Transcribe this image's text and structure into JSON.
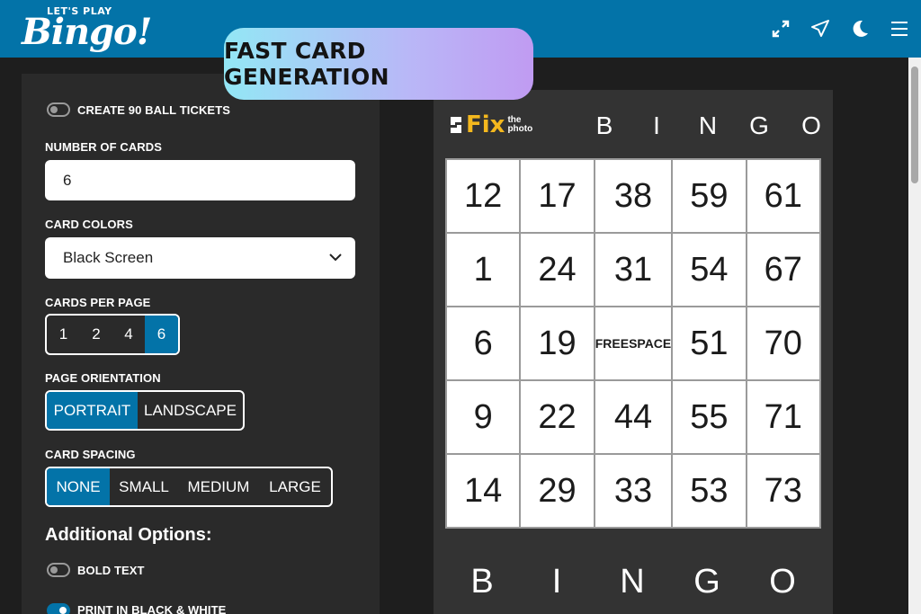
{
  "header": {
    "logo_small": "LET'S PLAY",
    "logo_big": "Bingo!",
    "icons": [
      "fullscreen-icon",
      "share-icon",
      "dark-mode-icon",
      "menu-icon"
    ]
  },
  "banner": {
    "text": "FAST CARD GENERATION"
  },
  "options": {
    "create90_label": "CREATE 90 BALL TICKETS",
    "num_cards_label": "NUMBER OF CARDS",
    "num_cards_value": "6",
    "colors_label": "CARD COLORS",
    "colors_value": "Black Screen",
    "per_page_label": "CARDS PER PAGE",
    "per_page": [
      "1",
      "2",
      "4",
      "6"
    ],
    "per_page_selected": "6",
    "orientation_label": "PAGE ORIENTATION",
    "orientation": [
      "PORTRAIT",
      "LANDSCAPE"
    ],
    "orientation_selected": "PORTRAIT",
    "spacing_label": "CARD SPACING",
    "spacing": [
      "NONE",
      "SMALL",
      "MEDIUM",
      "LARGE"
    ],
    "spacing_selected": "NONE",
    "additional_title": "Additional Options:",
    "bold_label": "BOLD TEXT",
    "bw_label": "PRINT IN BLACK & WHITE"
  },
  "card": {
    "brand_main": "Fix",
    "brand_sub1": "the",
    "brand_sub2": "photo",
    "letters": [
      "B",
      "I",
      "N",
      "G",
      "O"
    ],
    "rows": [
      [
        "12",
        "17",
        "38",
        "59",
        "61"
      ],
      [
        "1",
        "24",
        "31",
        "54",
        "67"
      ],
      [
        "6",
        "19",
        "FREE SPACE",
        "51",
        "70"
      ],
      [
        "9",
        "22",
        "44",
        "55",
        "71"
      ],
      [
        "14",
        "29",
        "33",
        "53",
        "73"
      ]
    ],
    "free_line1": "FREE",
    "free_line2": "SPACE"
  },
  "colors": {
    "header_blue": "#0373a8",
    "banner_start": "#93e7f5",
    "banner_end": "#c09bf2",
    "fix_yellow": "#f4b81e"
  }
}
